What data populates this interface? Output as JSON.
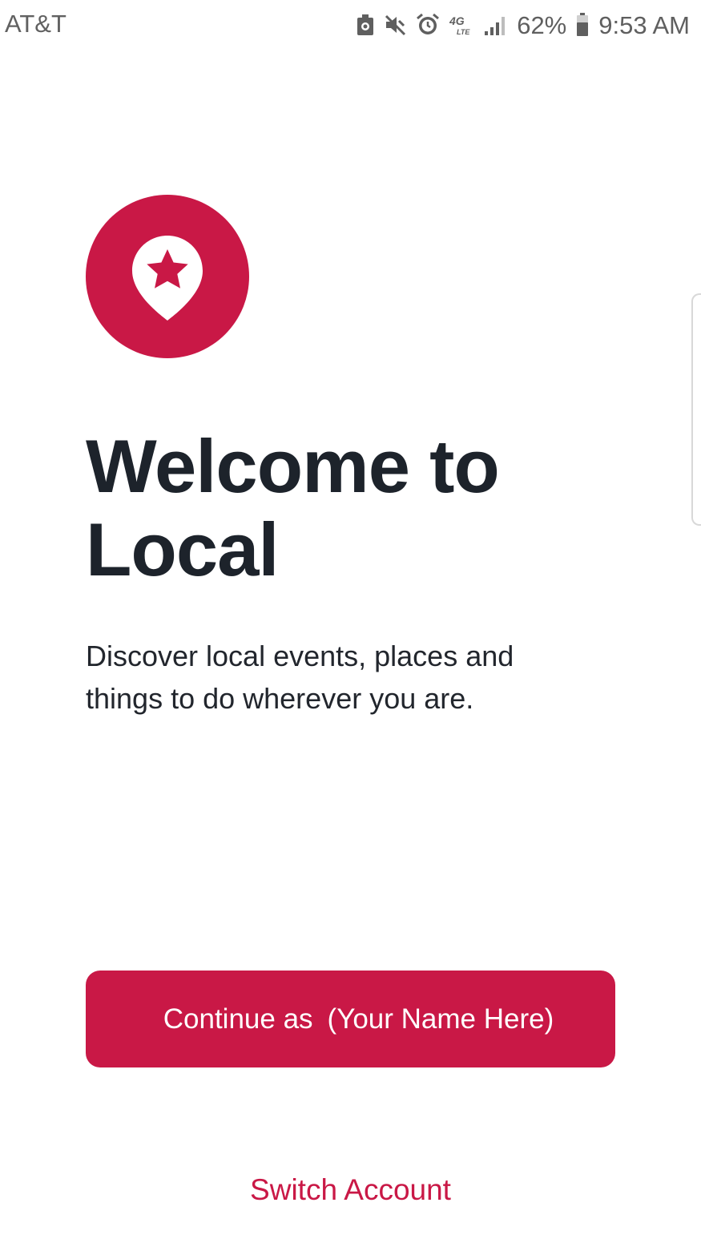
{
  "status_bar": {
    "carrier": "AT&T",
    "battery_percent": "62%",
    "time": "9:53 AM",
    "network": "4G LTE",
    "icons": [
      "media-saver-icon",
      "mute-icon",
      "alarm-icon",
      "4g-lte-icon",
      "signal-icon",
      "battery-icon"
    ]
  },
  "welcome": {
    "title": "Welcome to Local",
    "description": "Discover local events, places and things to do wherever you are."
  },
  "actions": {
    "continue_prefix": "Continue as",
    "continue_name": "(Your Name Here)",
    "switch_account": "Switch Account"
  },
  "colors": {
    "brand": "#c91846",
    "heading": "#1d232b",
    "body_text": "#22262d",
    "status_text": "#5f5f5f"
  }
}
